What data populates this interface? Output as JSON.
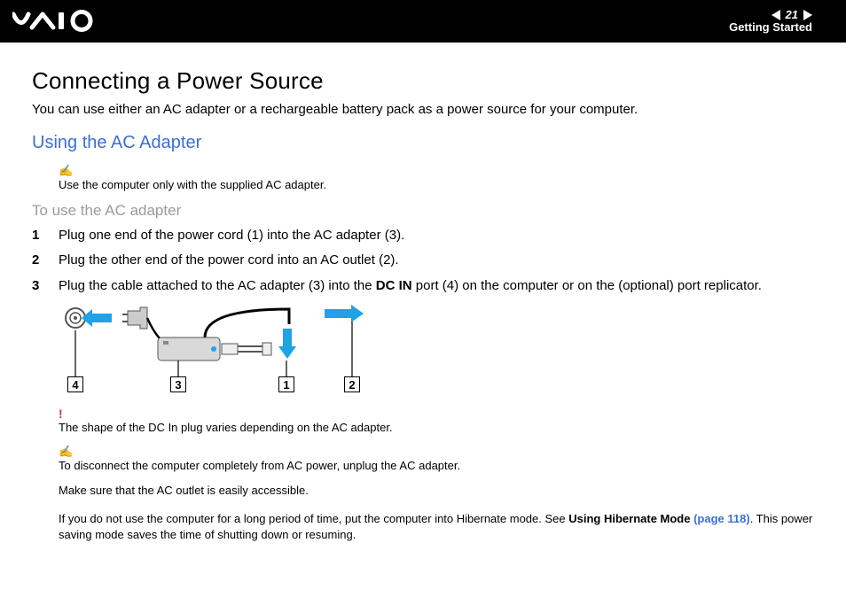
{
  "header": {
    "page_number": "21",
    "section": "Getting Started"
  },
  "title": "Connecting a Power Source",
  "intro": "You can use either an AC adapter or a rechargeable battery pack as a power source for your computer.",
  "h2": "Using the AC Adapter",
  "note1": "Use the computer only with the supplied AC adapter.",
  "subhead": "To use the AC adapter",
  "steps": {
    "s1": "Plug one end of the power cord (1) into the AC adapter (3).",
    "s2": "Plug the other end of the power cord into an AC outlet (2).",
    "s3_a": "Plug the cable attached to the AC adapter (3) into the ",
    "s3_b": "DC IN",
    "s3_c": " port (4) on the computer or on the (optional) port replicator."
  },
  "callouts": {
    "c1": "1",
    "c2": "2",
    "c3": "3",
    "c4": "4"
  },
  "warn": "The shape of the DC In plug varies depending on the AC adapter.",
  "note2": "To disconnect the computer completely from AC power, unplug the AC adapter.",
  "note3": "Make sure that the AC outlet is easily accessible.",
  "final_a": "If you do not use the computer for a long period of time, put the computer into Hibernate mode. See ",
  "final_b": "Using Hibernate Mode ",
  "final_link": "(page 118)",
  "final_c": ". This power saving mode saves the time of shutting down or resuming."
}
